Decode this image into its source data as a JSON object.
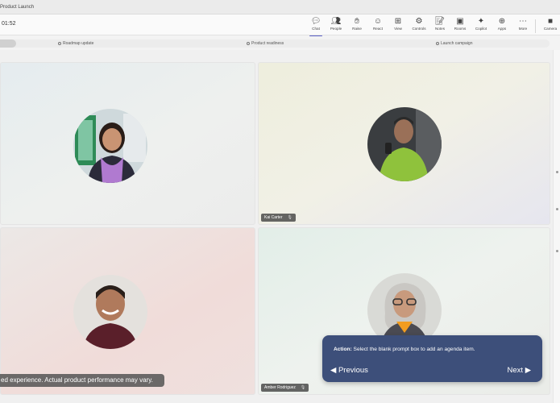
{
  "window": {
    "title": "Product Launch"
  },
  "meeting": {
    "timer": "01:52"
  },
  "toolbar": {
    "chat": "Chat",
    "people": "People",
    "people_count": "4",
    "raise": "Raise",
    "react": "React",
    "view": "View",
    "controls": "Controls",
    "notes": "Notes",
    "rooms": "Rooms",
    "copilot": "Copilot",
    "apps": "Apps",
    "more": "More",
    "camera": "Camera"
  },
  "agenda": {
    "items": [
      "Roadmap update",
      "Product readiness",
      "Launch campaign"
    ]
  },
  "participants": [
    {
      "name": ""
    },
    {
      "name": "Kai Carter"
    },
    {
      "name": ""
    },
    {
      "name": "Amber Rodriguez"
    }
  ],
  "disclaimer": {
    "text": "ed experience. Actual product performance may vary."
  },
  "coachmark": {
    "action_label": "Action:",
    "action_text": " Select the blank prompt box to add an agenda item.",
    "previous": "◀ Previous",
    "next": "Next ▶"
  },
  "colors": {
    "accent": "#5b5fc7",
    "coachmark_bg": "#3d4f7a"
  },
  "icons": {
    "chat": "chat-icon",
    "people": "people-icon",
    "raise": "hand-icon",
    "react": "smiley-icon",
    "view": "grid-icon",
    "controls": "controls-icon",
    "notes": "notes-icon",
    "rooms": "rooms-icon",
    "copilot": "copilot-icon",
    "apps": "apps-icon",
    "more": "more-icon",
    "camera": "camera-icon"
  }
}
